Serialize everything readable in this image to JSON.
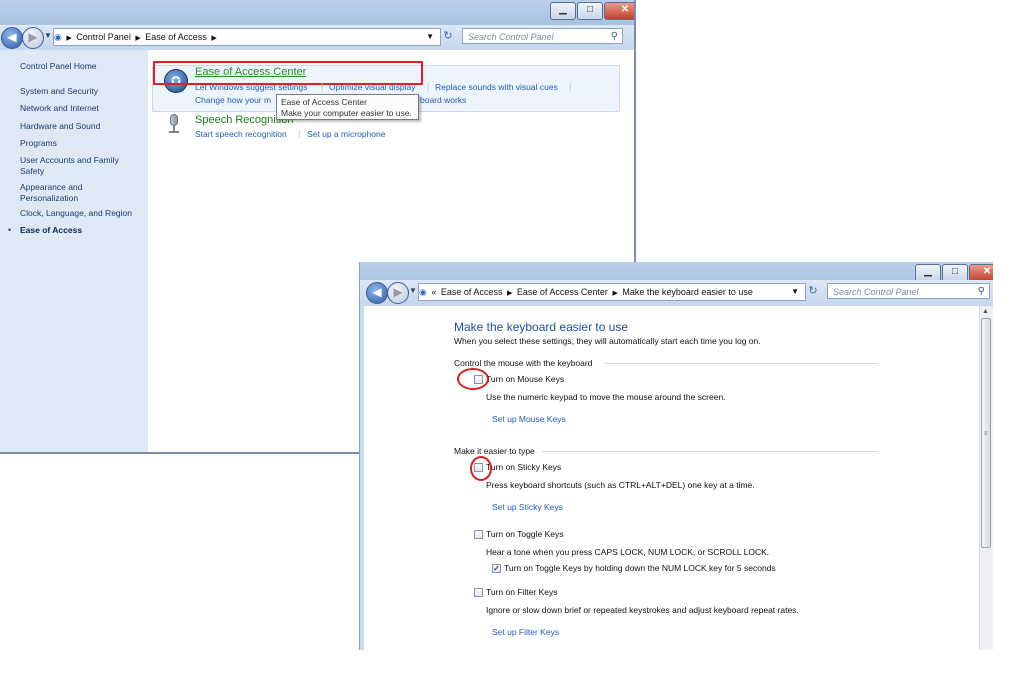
{
  "window1": {
    "navbar": {
      "breadcrumb": [
        "Control Panel",
        "Ease of Access"
      ],
      "search_placeholder": "Search Control Panel"
    },
    "sidebar": {
      "home": "Control Panel Home",
      "items": [
        "System and Security",
        "Network and Internet",
        "Hardware and Sound",
        "Programs",
        "User Accounts and Family Safety",
        "Appearance and Personalization",
        "Clock, Language, and Region",
        "Ease of Access"
      ]
    },
    "ease_center": {
      "title": "Ease of Access Center",
      "links": [
        "Let Windows suggest settings",
        "Optimize visual display",
        "Replace sounds with visual cues",
        "Change how your m",
        "board works"
      ]
    },
    "speech": {
      "title": "Speech Recognition",
      "links": [
        "Start speech recognition",
        "Set up a microphone"
      ]
    },
    "tooltip": {
      "title": "Ease of Access Center",
      "text": "Make your computer easier to use."
    }
  },
  "window2": {
    "navbar": {
      "overflow": "«",
      "breadcrumb": [
        "Ease of Access",
        "Ease of Access Center",
        "Make the keyboard easier to use"
      ],
      "search_placeholder": "Search Control Panel"
    },
    "page": {
      "title": "Make the keyboard easier to use",
      "subtitle": "When you select these settings, they will automatically start each time you log on."
    },
    "mouse_group": {
      "label": "Control the mouse with the keyboard",
      "checkbox": "Turn on Mouse Keys",
      "checked": false,
      "description": "Use the numeric keypad to move the mouse around the screen.",
      "setup_link": "Set up Mouse Keys"
    },
    "typing_group": {
      "label": "Make it easier to type",
      "sticky": {
        "checkbox": "Turn on Sticky Keys",
        "checked": false,
        "description": "Press keyboard shortcuts (such as CTRL+ALT+DEL) one key at a time.",
        "setup_link": "Set up Sticky Keys"
      },
      "toggle": {
        "checkbox": "Turn on Toggle Keys",
        "checked": false,
        "description": "Hear a tone when you press CAPS LOCK, NUM LOCK, or SCROLL LOCK.",
        "sub_checkbox": "Turn on Toggle Keys by holding down the NUM LOCK key for 5 seconds",
        "sub_checked": true
      },
      "filter": {
        "checkbox": "Turn on Filter Keys",
        "checked": false,
        "description": "Ignore or slow down brief or repeated keystrokes and adjust keyboard repeat rates.",
        "setup_link": "Set up Filter Keys"
      }
    }
  },
  "colors": {
    "link": "#1f5fb0",
    "heading_green": "#1b7a1b",
    "annotation_red": "#e2201f",
    "page_title_blue": "#1d4f9c"
  }
}
